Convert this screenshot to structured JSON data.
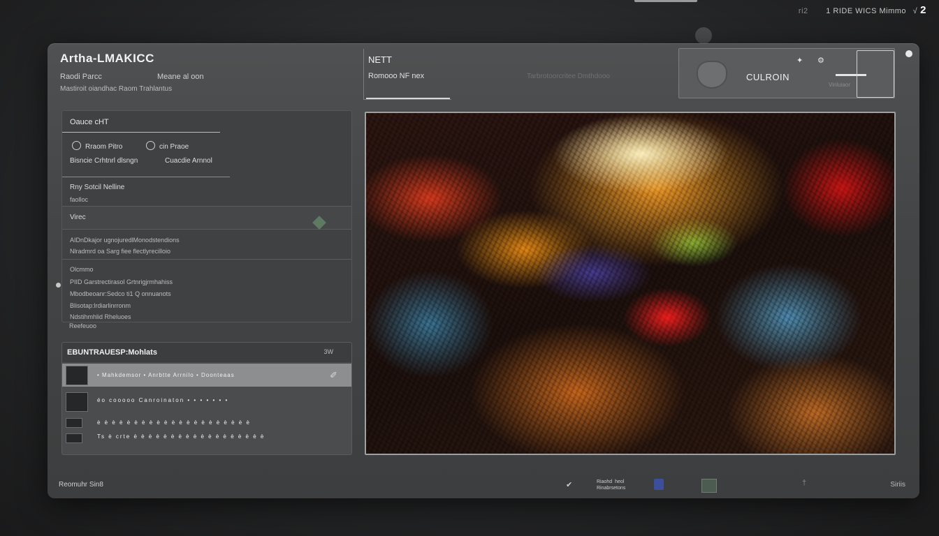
{
  "system_status": {
    "text": "1  RIDE  WICS  Mimmo",
    "glyph": "√",
    "badge": "2",
    "left_marker": "ri2"
  },
  "app": {
    "title": "Artha-LMAKICC",
    "sub_left": "Raodi  Parcc",
    "sub_right": "Meane  al oon",
    "sub_line2": "Mastiroit  oiandhac  Raom  Trahlantus"
  },
  "panel": {
    "heading": "Oauce  cHT",
    "options": [
      {
        "label": "Rraom  Pitro",
        "icon": "radio-icon"
      },
      {
        "label": "cin  Praoe",
        "icon": "radio-icon"
      }
    ],
    "option_row2_left": "Bisncie  Crhtnrl  dlsngn",
    "option_row2_right": "Cuacdie  Arnnol",
    "field_label": "Rny  Sotcil  Nelline",
    "field_sub": "faolloc",
    "section_title": "Virec",
    "section_line1": "AIDnDkajor  ugnojuredlMonodstendions",
    "section_line2": "Nlradmrd  oa  Sarg  fiee  flectlyrecilloio",
    "info_heading": "Olcmmo",
    "info_lines": [
      "PIID  Garstrectirasol  Grtnrigjrmhahiss",
      "Mbodbeoanr:Sedco  ti1  Q  onnuanots",
      "Blisotap:lrdiarlinrronm",
      "Ndstihmhlid  Rheluoes"
    ],
    "info_footer": "Reefeuoo"
  },
  "table": {
    "title": "EBUNTRAUESP:Mohlats",
    "count": "3W",
    "rows": [
      {
        "text": "•  Mahkdemsor  •  Anrbtte  Arrnilo  •  Doonteaas",
        "selected": true
      },
      {
        "text": "éo  cooooo    Canroinaton  •  •  •  •  •  •  •"
      },
      {
        "text": "è è è è è è è è è è è è è è è è è è è è è"
      },
      {
        "text": "Ts  è crte è è è è è è è è è è è è è è è è è è"
      }
    ]
  },
  "footer": {
    "left": "Reomuhr  Sin8",
    "center_text": "Riaohd  heol\nRinabrsetons",
    "right": "Siriis"
  },
  "top_info": {
    "title": "NETT",
    "subtitle": "Romooo  NF nex",
    "caption": "Tarbrotoorcritee  Dmthdooo"
  },
  "custom_card": {
    "label": "CULROIN",
    "faint": "Vinluiaor"
  },
  "icons": {
    "check": "check-icon",
    "shield": "shield-icon",
    "grid": "grid-icon",
    "flag": "flag-icon",
    "diamond": "diamond-icon",
    "brush": "brush-icon",
    "pin": "pin-icon"
  },
  "colors": {
    "window_bg": "#454748",
    "accent_green": "#5e7a63",
    "selected_row": "#8c8e90"
  }
}
